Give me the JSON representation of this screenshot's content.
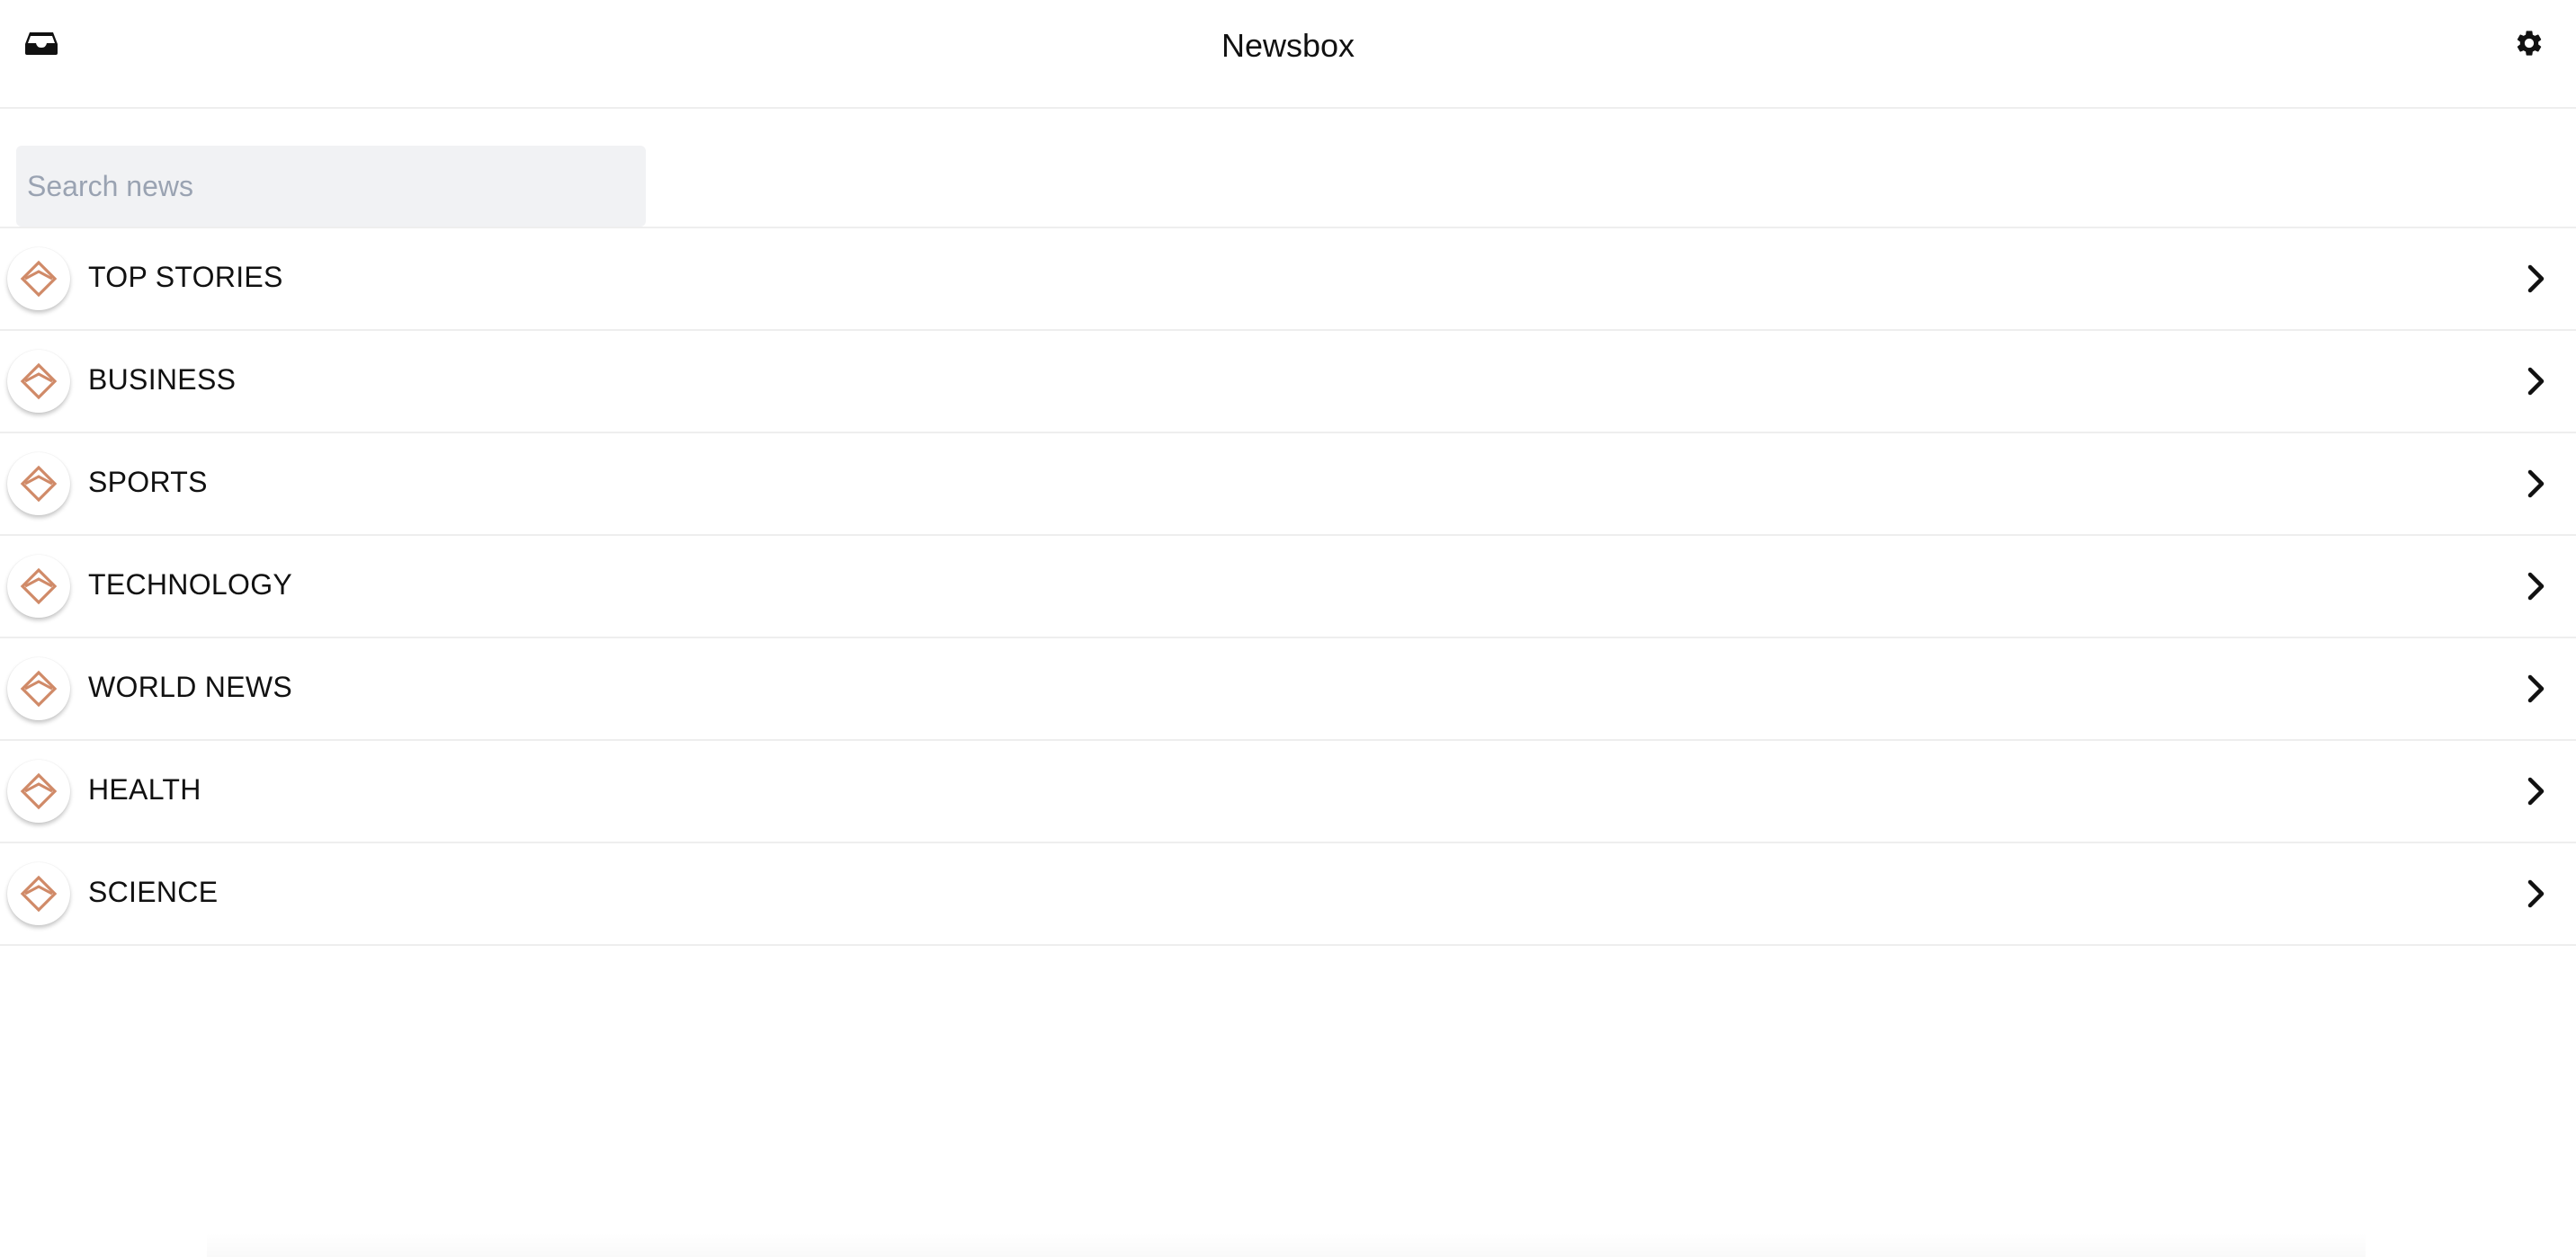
{
  "header": {
    "title": "Newsbox",
    "left_icon": "inbox-icon",
    "right_icon": "gear-icon"
  },
  "search": {
    "placeholder": "Search news",
    "value": ""
  },
  "categories": [
    {
      "label": "TOP STORIES",
      "icon": "kite-logo-icon"
    },
    {
      "label": "BUSINESS",
      "icon": "kite-logo-icon"
    },
    {
      "label": "SPORTS",
      "icon": "kite-logo-icon"
    },
    {
      "label": "TECHNOLOGY",
      "icon": "kite-logo-icon"
    },
    {
      "label": "WORLD NEWS",
      "icon": "kite-logo-icon"
    },
    {
      "label": "HEALTH",
      "icon": "kite-logo-icon"
    },
    {
      "label": "SCIENCE",
      "icon": "kite-logo-icon"
    }
  ],
  "colors": {
    "accent": "#d08a68",
    "divider": "#eeeeee",
    "search_bg": "#f1f2f4",
    "placeholder": "#9aa3b2"
  }
}
